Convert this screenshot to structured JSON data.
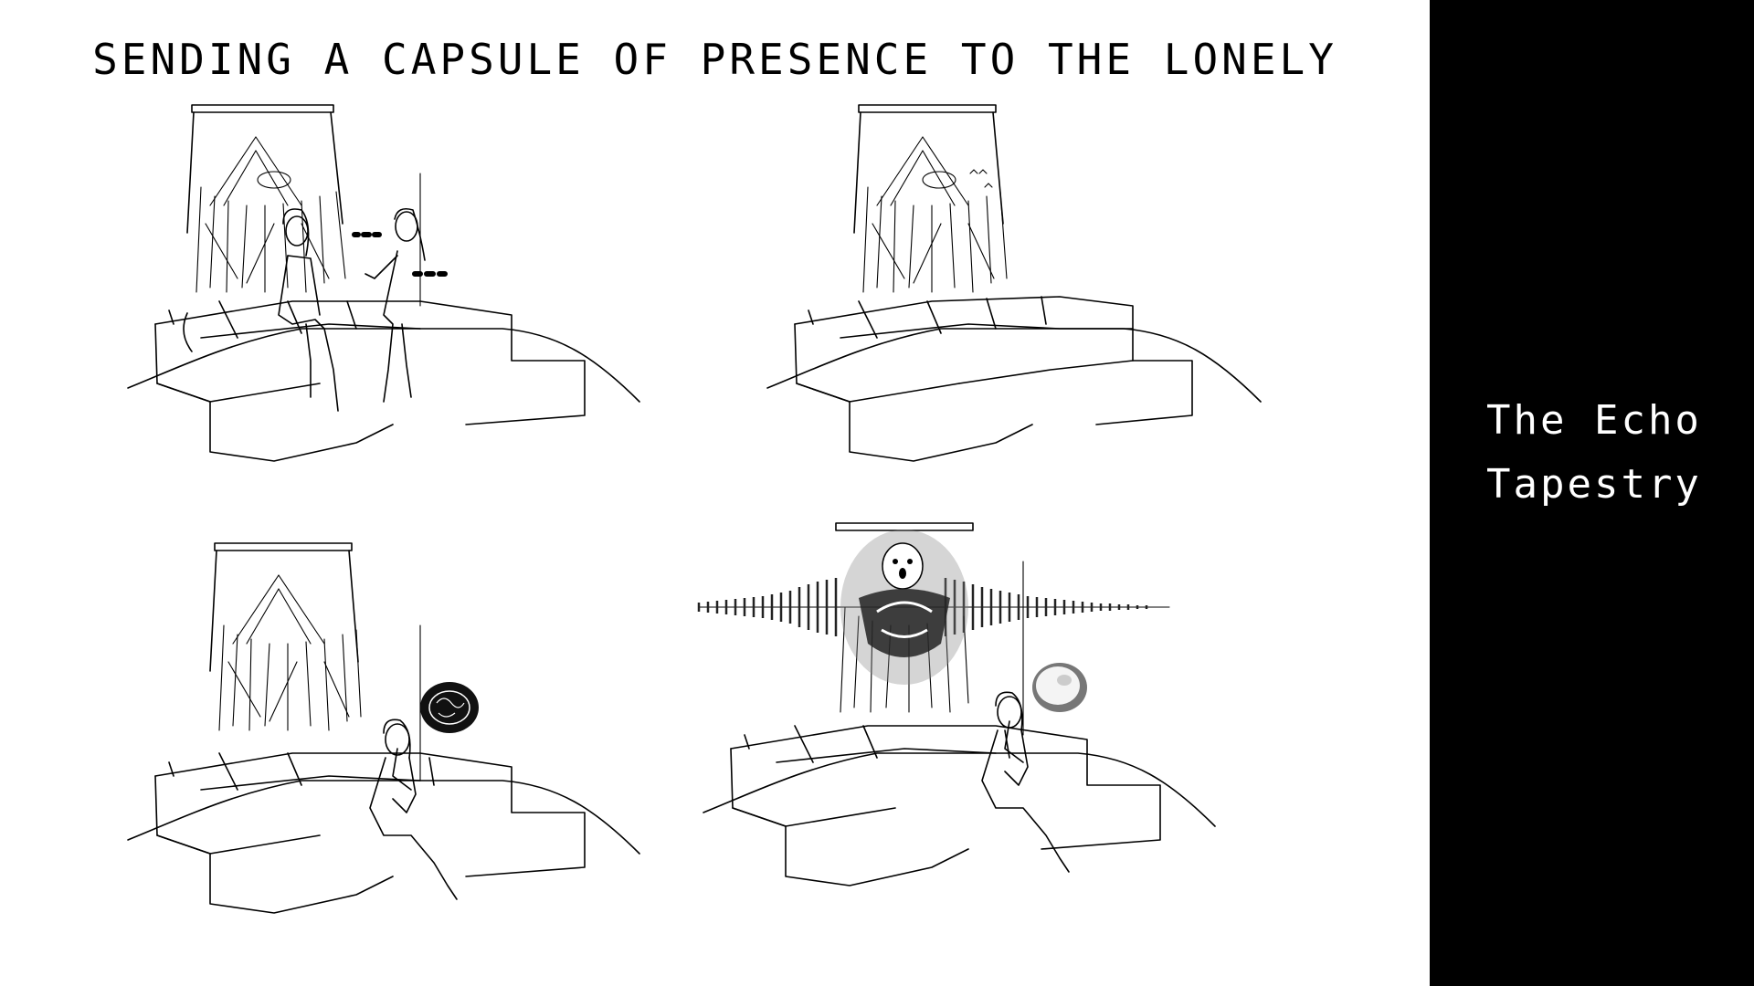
{
  "page": {
    "title": "SENDING A CAPSULE OF PRESENCE TO THE LONELY"
  },
  "side_panel": {
    "title_line1": "The Echo",
    "title_line2": "Tapestry",
    "background_color": "#000000",
    "text_color": "#ffffff"
  },
  "panels": [
    {
      "name": "two-people-talking",
      "speech_marks": [
        "---",
        "---"
      ]
    },
    {
      "name": "empty-sofa"
    },
    {
      "name": "lonely-person-with-dark-capsule"
    },
    {
      "name": "tapestry-echo-with-light-capsule"
    }
  ]
}
